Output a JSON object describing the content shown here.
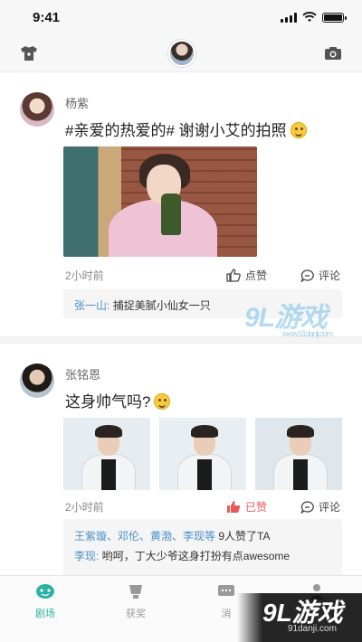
{
  "status_bar": {
    "time": "9:41"
  },
  "top_nav": {
    "left_icon": "shirt-icon",
    "center_icon": "user-avatar",
    "right_icon": "camera-icon"
  },
  "posts": [
    {
      "username": "杨紫",
      "text": "#亲爱的热爱的# 谢谢小艾的拍照",
      "emoji": "smile-emoji",
      "time": "2小时前",
      "like_label": "点赞",
      "comment_label": "评论",
      "comments": [
        {
          "name": "张一山:",
          "text": "捕捉美腻小仙女一只"
        }
      ]
    },
    {
      "username": "张铭恩",
      "text": "这身帅气吗?",
      "emoji": "smile-emoji",
      "time": "2小时前",
      "like_label": "已赞",
      "comment_label": "评论",
      "likes_line": {
        "names": "王紫璇、邓伦、黄渤、李现等",
        "suffix": "9人赞了TA"
      },
      "comments": [
        {
          "name": "李现:",
          "text": "哟呵，丁大少爷这身打扮有点awesome"
        }
      ]
    }
  ],
  "tabs": [
    {
      "label": "剧场",
      "icon": "theater-icon",
      "active": true
    },
    {
      "label": "获奖",
      "icon": "trophy-icon",
      "active": false
    },
    {
      "label": "消",
      "icon": "message-icon",
      "active": false
    },
    {
      "label": "",
      "icon": "profile-icon",
      "active": false
    }
  ],
  "watermarks": {
    "mid": "9L游戏",
    "mid_domain": "www.91danji.com",
    "corner": "9L游戏",
    "corner_domain": "91danji.com"
  },
  "colors": {
    "accent": "#2bb3a0",
    "link": "#4a90c8",
    "liked": "#e85a5a"
  }
}
